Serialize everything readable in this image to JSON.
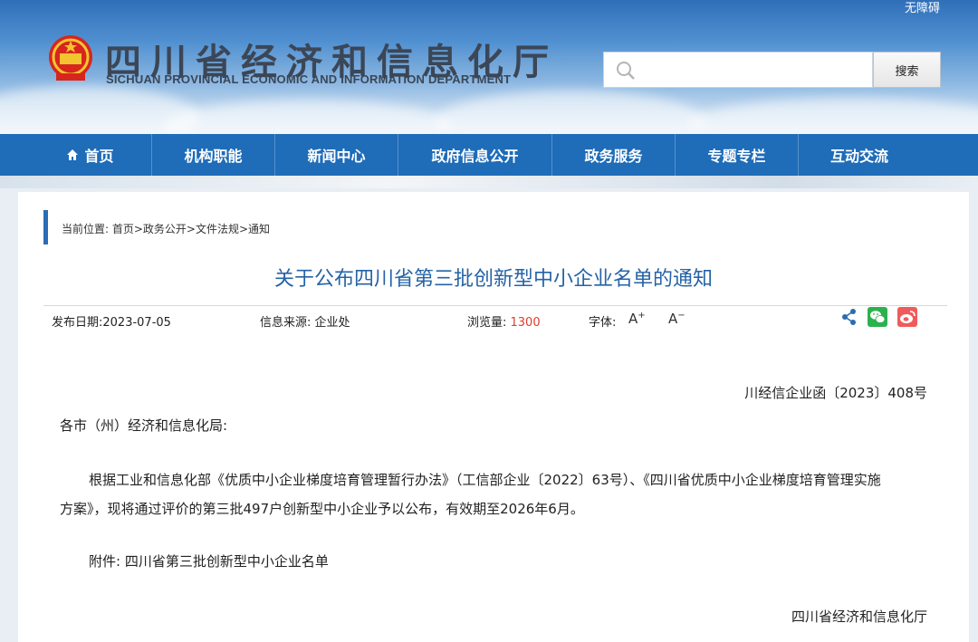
{
  "header": {
    "accessibility": "无障碍",
    "title": "四川省经济和信息化厅",
    "subtitle": "SICHUAN PROVINCIAL ECONOMIC AND INFORMATION DEPARTMENT",
    "search_placeholder": "",
    "search_button": "搜索"
  },
  "nav": {
    "items": [
      "首页",
      "机构职能",
      "新闻中心",
      "政府信息公开",
      "政务服务",
      "专题专栏",
      "互动交流"
    ]
  },
  "breadcrumb": "当前位置: 首页>政务公开>文件法规>通知",
  "article": {
    "title": "关于公布四川省第三批创新型中小企业名单的通知",
    "date": "发布日期:2023-07-05",
    "source": "信息来源:  企业处",
    "views_label": "浏览量: ",
    "views_value": "1300",
    "font_label": "字体:",
    "font_increase": "A",
    "font_decrease": "A",
    "doc_number": "川经信企业函〔2023〕408号",
    "salutation": "各市（州）经济和信息化局:",
    "body_line1": "根据工业和信息化部《优质中小企业梯度培育管理暂行办法》（工信部企业〔2022〕63号）、《四川省优质中小企业梯度培育管理实施",
    "body_line2": "方案》，现将通过评价的第三批497户创新型中小企业予以公布，有效期至2026年6月。",
    "attachment": "附件: 四川省第三批创新型中小企业名单",
    "signature": "四川省经济和信息化厅"
  },
  "colors": {
    "nav_bg": "#1f6cb8",
    "title_blue": "#2563a6",
    "views_red": "#e23b2c",
    "wechat_green": "#2bb24c",
    "weibo_red": "#e6162d"
  }
}
